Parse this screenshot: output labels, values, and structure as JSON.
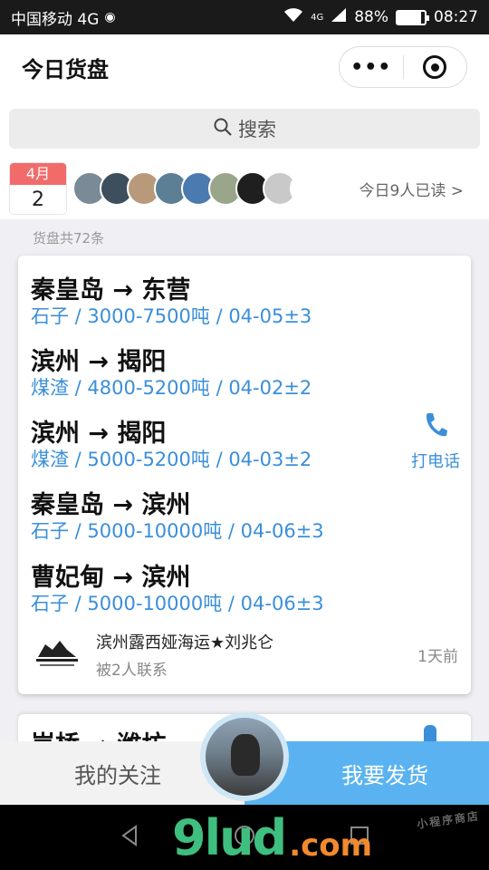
{
  "status_bar": {
    "carrier": "中国移动 4G",
    "network": "4G",
    "battery": "88%",
    "time": "08:27",
    "battery_level": 0.88
  },
  "header": {
    "title": "今日货盘"
  },
  "search": {
    "label": "搜索"
  },
  "readers": {
    "month": "4月",
    "day": "2",
    "summary": "今日9人已读 >",
    "avatar_colors": [
      "#7a8a96",
      "#3d4f5c",
      "#b89a7a",
      "#5c7f95",
      "#4a7ab0",
      "#9aa68a",
      "#1f1f1f",
      "#c9c9c9",
      "#ffffff"
    ]
  },
  "list": {
    "count_label": "货盘共72条"
  },
  "card": {
    "routes": [
      {
        "title": "秦皇岛 → 东营",
        "detail": "石子 / 3000-7500吨 / 04-05±3"
      },
      {
        "title": "滨州 → 揭阳",
        "detail": "煤渣 / 4800-5200吨 / 04-02±2"
      },
      {
        "title": "滨州 → 揭阳",
        "detail": "煤渣 / 5000-5200吨 / 04-03±2"
      },
      {
        "title": "秦皇岛 → 滨州",
        "detail": "石子 / 5000-10000吨 / 04-06±3"
      },
      {
        "title": "曹妃甸 → 滨州",
        "detail": "石子 / 5000-10000吨 / 04-06±3"
      }
    ],
    "call_label": "打电话",
    "company": "滨州露西娅海运★刘兆仑",
    "contacts": "被2人联系",
    "time_ago": "1天前"
  },
  "card2": {
    "title": "岚桥 → 潍坊"
  },
  "bottom": {
    "follow_label": "我的关注",
    "ship_label": "我要发货"
  },
  "watermark": {
    "big": "9lud",
    "small": ".com",
    "side": "小程序商店"
  },
  "colors": {
    "accent": "#3b8fd9",
    "ship_button": "#5ab3f0",
    "calendar_red": "#f26b6b"
  }
}
